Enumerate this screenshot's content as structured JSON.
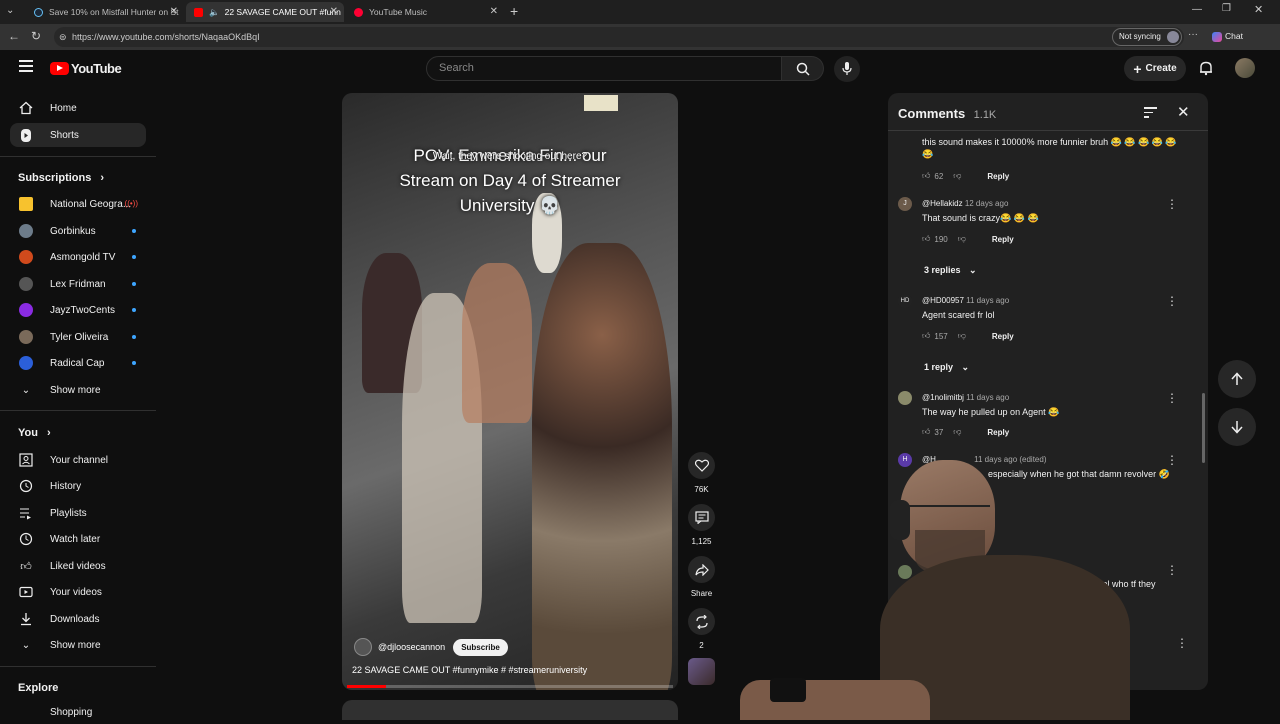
{
  "browser": {
    "tabs": [
      {
        "title": "Save 10% on Mistfall Hunter on St"
      },
      {
        "title": "22 SAVAGE CAME OUT #funn"
      },
      {
        "title": "YouTube Music"
      }
    ],
    "url": "https://www.youtube.com/shorts/NaqaaOKdBqI",
    "sync_label": "Not syncing",
    "chat_label": "Chat"
  },
  "header": {
    "logo_text": "YouTube",
    "search_placeholder": "Search",
    "create_label": "Create"
  },
  "sidebar": {
    "main": [
      {
        "label": "Home",
        "icon": "home-icon"
      },
      {
        "label": "Shorts",
        "icon": "shorts-icon"
      }
    ],
    "subscriptions_title": "Subscriptions",
    "subscriptions": [
      {
        "label": "National Geogra...",
        "color": "#f7c22e"
      },
      {
        "label": "Gorbinkus",
        "color": "#6d7c8a"
      },
      {
        "label": "Asmongold TV",
        "color": "#d04a1c"
      },
      {
        "label": "Lex Fridman",
        "color": "#555555"
      },
      {
        "label": "JayzTwoCents",
        "color": "#8a2be2"
      },
      {
        "label": "Tyler Oliveira",
        "color": "#7a6a5a"
      },
      {
        "label": "Radical Cap",
        "color": "#2b5fd9"
      }
    ],
    "show_more": "Show more",
    "you_title": "You",
    "you_items": [
      {
        "label": "Your channel"
      },
      {
        "label": "History"
      },
      {
        "label": "Playlists"
      },
      {
        "label": "Watch later"
      },
      {
        "label": "Liked videos"
      },
      {
        "label": "Your videos"
      },
      {
        "label": "Downloads"
      },
      {
        "label": "Show more"
      }
    ],
    "explore_title": "Explore",
    "explore_first": "Shopping"
  },
  "video": {
    "caption_lines": [
      "POV: Emmerika Fin... our",
      "Stream on Day 4 of Streamer",
      "University 💀"
    ],
    "subtitle": "Wait, they were shooting out here?",
    "channel": "@djloosecannon",
    "subscribe_label": "Subscribe",
    "title": "22 SAVAGE CAME OUT #funnymike # #streameruniversity",
    "progress": 0.12
  },
  "actions": {
    "likes": "76K",
    "comments": "1,125",
    "share": "Share",
    "remix": "2"
  },
  "comments": {
    "title": "Comments",
    "count": "1.1K",
    "items": [
      {
        "text_a": "this sound makes it 10000% more funnier bruh 😂 😂 😂 😂 😂",
        "text_b": "😂",
        "likes": "62",
        "reply": "Reply"
      },
      {
        "author": "@Hellakidz",
        "time": "12 days ago",
        "text": "That sound is crazy😂 😂 😂",
        "likes": "190",
        "reply": "Reply",
        "replies": "3 replies",
        "avatar_letter": "J"
      },
      {
        "author": "@HD00957",
        "time": "11 days ago",
        "text": "Agent scared fr lol",
        "likes": "157",
        "reply": "Reply",
        "replies": "1 reply",
        "avatar_letter": "HD"
      },
      {
        "author": "@1nolimitbj",
        "time": "11 days ago",
        "text": "The way he pulled up on Agent 😂",
        "likes": "37",
        "reply": "Reply"
      },
      {
        "author": "@H",
        "time": "11 days ago (edited)",
        "text": "especially when he got that damn revolver 🤣",
        "avatar_letter": "H"
      },
      {
        "text": "around lol who tf they"
      }
    ]
  }
}
